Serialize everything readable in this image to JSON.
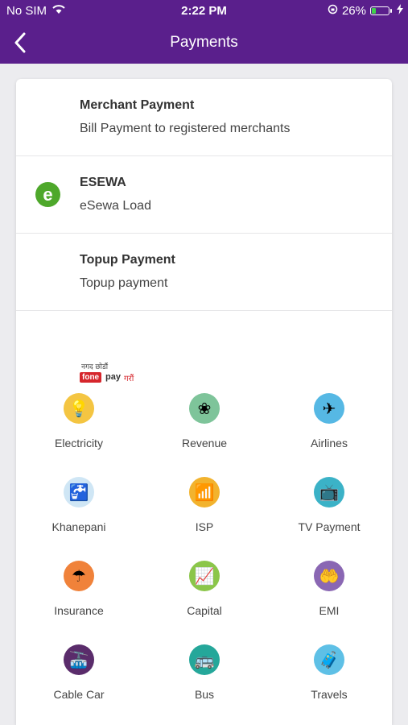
{
  "status_bar": {
    "carrier": "No SIM",
    "time": "2:22 PM",
    "battery": "26%",
    "battery_level": 0.26
  },
  "nav": {
    "title": "Payments"
  },
  "rows": [
    {
      "title": "Merchant Payment",
      "subtitle": "Bill Payment to registered merchants"
    },
    {
      "title": "ESEWA",
      "subtitle": "eSewa Load",
      "logo_letter": "e"
    },
    {
      "title": "Topup Payment",
      "subtitle": "Topup payment"
    }
  ],
  "fonepay": {
    "tagline": "नगद छोडौं",
    "brand": "fone",
    "pay": "pay",
    "garo": "गरौं"
  },
  "services": [
    {
      "label": "Electricity",
      "icon": "bulb-icon",
      "glyph": "💡",
      "color": "#f4c542"
    },
    {
      "label": "Revenue",
      "icon": "emblem-icon",
      "glyph": "❀",
      "color": "#7ec49a"
    },
    {
      "label": "Airlines",
      "icon": "airplane-icon",
      "glyph": "✈",
      "color": "#56b8e4"
    },
    {
      "label": "Khanepani",
      "icon": "tap-icon",
      "glyph": "🚰",
      "color": "#cfe6f5"
    },
    {
      "label": "ISP",
      "icon": "router-icon",
      "glyph": "📶",
      "color": "#f2b32e"
    },
    {
      "label": "TV Payment",
      "icon": "tv-icon",
      "glyph": "📺",
      "color": "#3bb2c7"
    },
    {
      "label": "Insurance",
      "icon": "umbrella-icon",
      "glyph": "☂",
      "color": "#f0823a"
    },
    {
      "label": "Capital",
      "icon": "chart-icon",
      "glyph": "📈",
      "color": "#8bc64a"
    },
    {
      "label": "EMI",
      "icon": "hand-coin-icon",
      "glyph": "🤲",
      "color": "#8a67b3"
    },
    {
      "label": "Cable Car",
      "icon": "cable-car-icon",
      "glyph": "🚠",
      "color": "#5a2c6b"
    },
    {
      "label": "Bus",
      "icon": "bus-icon",
      "glyph": "🚌",
      "color": "#25a79a"
    },
    {
      "label": "Travels",
      "icon": "suitcase-icon",
      "glyph": "🧳",
      "color": "#5ec0e6"
    }
  ]
}
